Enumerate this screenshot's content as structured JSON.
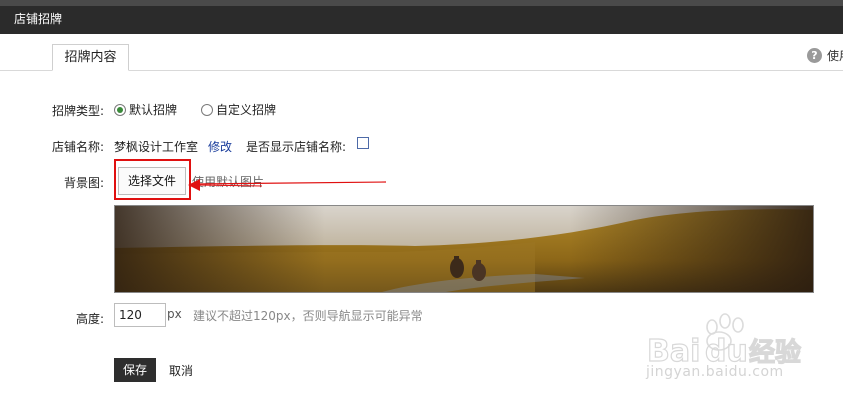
{
  "window": {
    "title": "店铺招牌"
  },
  "tabs": [
    {
      "label": "招牌内容"
    }
  ],
  "help": {
    "label": "使用"
  },
  "form": {
    "type": {
      "label": "招牌类型:",
      "options": [
        {
          "label": "默认招牌",
          "selected": true
        },
        {
          "label": "自定义招牌",
          "selected": false
        }
      ]
    },
    "store_name": {
      "label": "店铺名称:",
      "value": "梦枫设计工作室",
      "edit_link": "修改",
      "show_label": "是否显示店铺名称:",
      "show_checked": false
    },
    "background": {
      "label": "背景图:",
      "choose_file_label": "选择文件",
      "default_image_text": "使用默认图片"
    },
    "height": {
      "label": "高度:",
      "value": "120",
      "unit": "px",
      "hint": "建议不超过120px，否则导航显示可能异常"
    },
    "save_label": "保存",
    "cancel_label": "取消"
  },
  "watermark": {
    "text": "Baidu经验",
    "url": "jingyan.baidu.com"
  },
  "colors": {
    "titlebar": "#2b2b2b",
    "annotation": "#e01010",
    "save_button": "#2e2e2e",
    "link": "#1a3d9c"
  }
}
